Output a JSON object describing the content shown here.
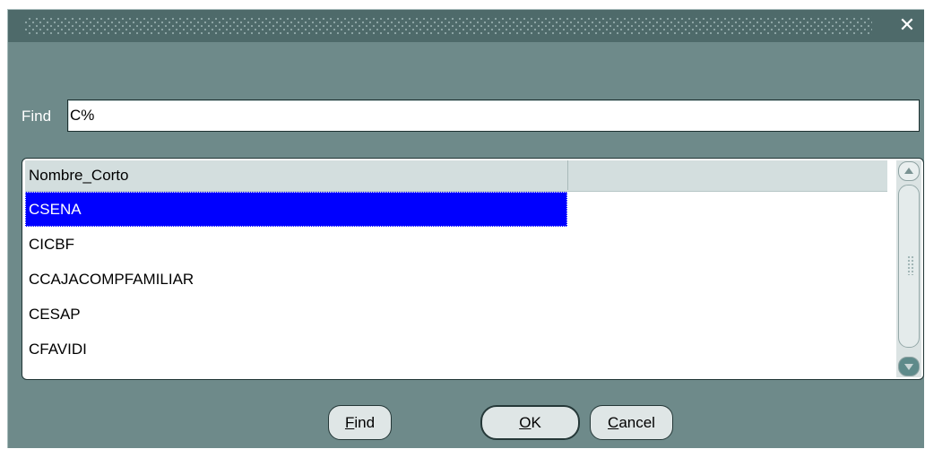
{
  "window": {
    "close_symbol": "✕",
    "close_icon": "close-icon"
  },
  "search": {
    "label": "Find",
    "value": "C%"
  },
  "list": {
    "column_header": "Nombre_Corto",
    "rows": [
      "CSENA",
      "CICBF",
      "CCAJACOMPFAMILIAR",
      "CESAP",
      "CFAVIDI"
    ],
    "selected_index": 0
  },
  "buttons": {
    "find": {
      "mnemonic": "F",
      "rest": "ind"
    },
    "ok": {
      "mnemonic": "O",
      "rest": "K"
    },
    "cancel": {
      "mnemonic": "C",
      "rest": "ancel"
    }
  },
  "colors": {
    "window_bg": "#6e8a8a",
    "titlebar_bg": "#4e6a6a",
    "selection_bg": "#0000ff",
    "header_bg": "#d3dede"
  }
}
